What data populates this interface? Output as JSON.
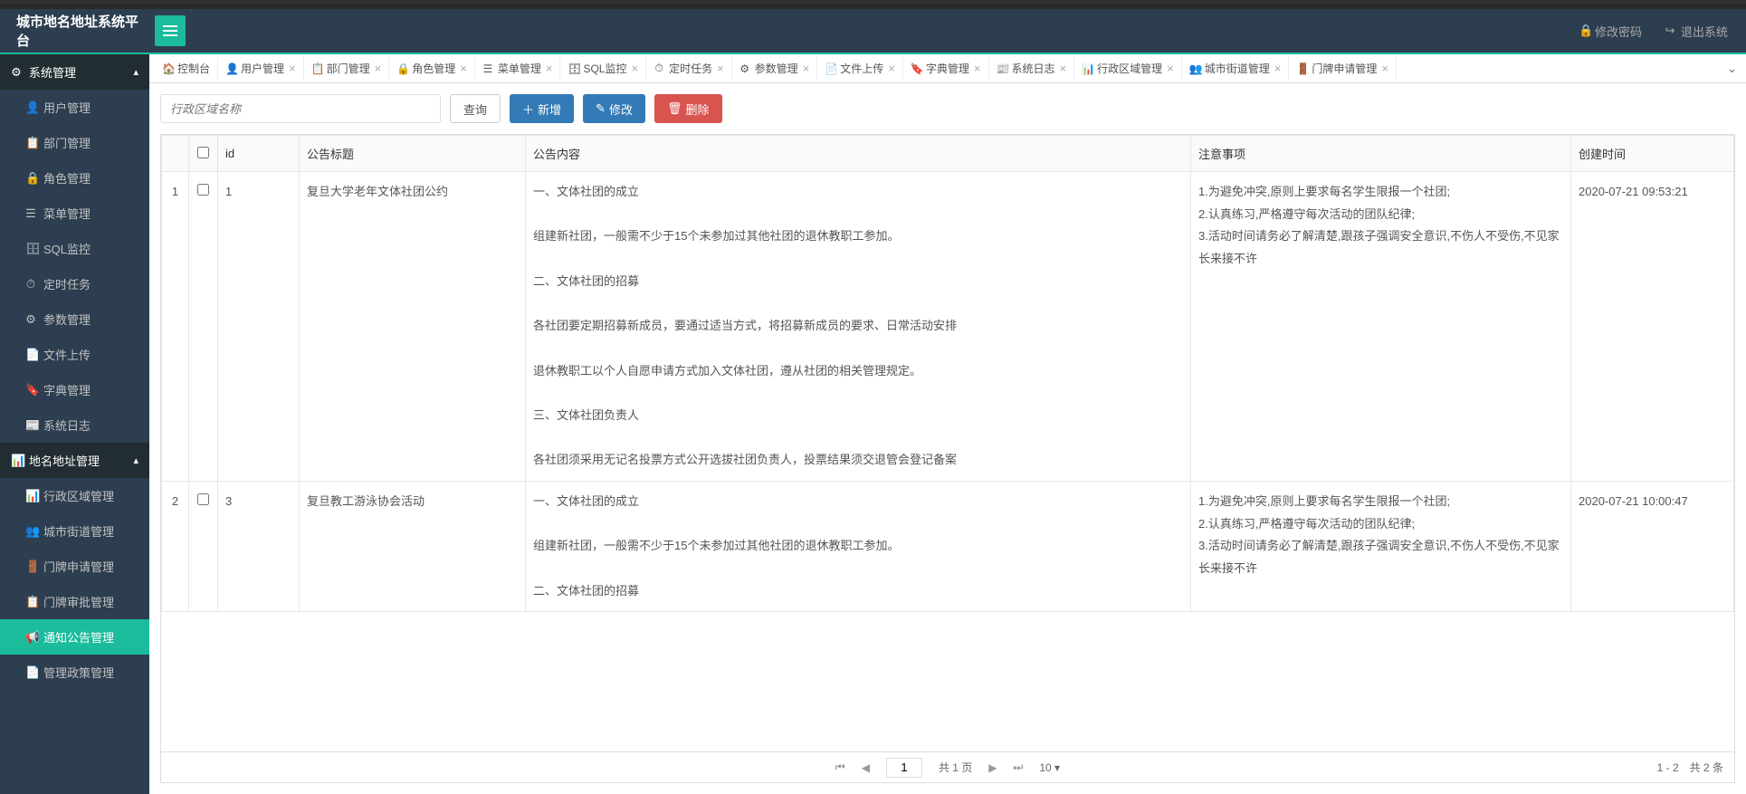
{
  "header": {
    "brand": "城市地名地址系统平台",
    "change_pwd": "修改密码",
    "logout": "退出系统"
  },
  "sidebar": {
    "group1": "系统管理",
    "group2": "地名地址管理",
    "items1": [
      {
        "icon": "👤",
        "label": "用户管理"
      },
      {
        "icon": "📋",
        "label": "部门管理"
      },
      {
        "icon": "🔒",
        "label": "角色管理"
      },
      {
        "icon": "☰",
        "label": "菜单管理"
      },
      {
        "icon": "🗄",
        "label": "SQL监控"
      },
      {
        "icon": "⏱",
        "label": "定时任务"
      },
      {
        "icon": "⚙",
        "label": "参数管理"
      },
      {
        "icon": "📄",
        "label": "文件上传"
      },
      {
        "icon": "🔖",
        "label": "字典管理"
      },
      {
        "icon": "📰",
        "label": "系统日志"
      }
    ],
    "items2": [
      {
        "icon": "📊",
        "label": "行政区域管理"
      },
      {
        "icon": "👥",
        "label": "城市街道管理"
      },
      {
        "icon": "🚪",
        "label": "门牌申请管理"
      },
      {
        "icon": "📋",
        "label": "门牌审批管理"
      },
      {
        "icon": "📢",
        "label": "通知公告管理",
        "active": true
      },
      {
        "icon": "📄",
        "label": "管理政策管理"
      }
    ]
  },
  "tabs": [
    {
      "icon": "🏠",
      "label": "控制台",
      "closable": false
    },
    {
      "icon": "👤",
      "label": "用户管理",
      "closable": true
    },
    {
      "icon": "📋",
      "label": "部门管理",
      "closable": true
    },
    {
      "icon": "🔒",
      "label": "角色管理",
      "closable": true
    },
    {
      "icon": "☰",
      "label": "菜单管理",
      "closable": true
    },
    {
      "icon": "🗄",
      "label": "SQL监控",
      "closable": true
    },
    {
      "icon": "⏱",
      "label": "定时任务",
      "closable": true
    },
    {
      "icon": "⚙",
      "label": "参数管理",
      "closable": true
    },
    {
      "icon": "📄",
      "label": "文件上传",
      "closable": true
    },
    {
      "icon": "🔖",
      "label": "字典管理",
      "closable": true
    },
    {
      "icon": "📰",
      "label": "系统日志",
      "closable": true
    },
    {
      "icon": "📊",
      "label": "行政区域管理",
      "closable": true
    },
    {
      "icon": "👥",
      "label": "城市街道管理",
      "closable": true
    },
    {
      "icon": "🚪",
      "label": "门牌申请管理",
      "closable": true
    }
  ],
  "toolbar": {
    "search_placeholder": "行政区域名称",
    "query": "查询",
    "add": "新增",
    "edit": "修改",
    "delete": "删除"
  },
  "table": {
    "headers": {
      "id": "id",
      "title": "公告标题",
      "content": "公告内容",
      "notice": "注意事项",
      "time": "创建时间"
    },
    "rows": [
      {
        "num": "1",
        "id": "1",
        "title": "复旦大学老年文体社团公约",
        "content": "一、文体社团的成立\n\n组建新社团，一般需不少于15个未参加过其他社团的退休教职工参加。\n\n二、文体社团的招募\n\n各社团要定期招募新成员，要通过适当方式，将招募新成员的要求、日常活动安排\n\n退休教职工以个人自愿申请方式加入文体社团，遵从社团的相关管理规定。\n\n三、文体社团负责人\n\n各社团须采用无记名投票方式公开选拔社团负责人，投票结果须交退管会登记备案",
        "notice": "1.为避免冲突,原则上要求每名学生限报一个社团;\n2.认真练习,严格遵守每次活动的团队纪律;\n3.活动时间请务必了解清楚,跟孩子强调安全意识,不伤人不受伤,不见家长来接不许",
        "time": "2020-07-21 09:53:21"
      },
      {
        "num": "2",
        "id": "3",
        "title": "复旦教工游泳协会活动",
        "content": "一、文体社团的成立\n\n组建新社团，一般需不少于15个未参加过其他社团的退休教职工参加。\n\n二、文体社团的招募",
        "notice": "1.为避免冲突,原则上要求每名学生限报一个社团;\n2.认真练习,严格遵守每次活动的团队纪律;\n3.活动时间请务必了解清楚,跟孩子强调安全意识,不伤人不受伤,不见家长来接不许",
        "time": "2020-07-21 10:00:47"
      }
    ]
  },
  "pager": {
    "page": "1",
    "total_pages_label": "共 1 页",
    "page_size": "10",
    "info": "1 - 2　共 2 条"
  }
}
